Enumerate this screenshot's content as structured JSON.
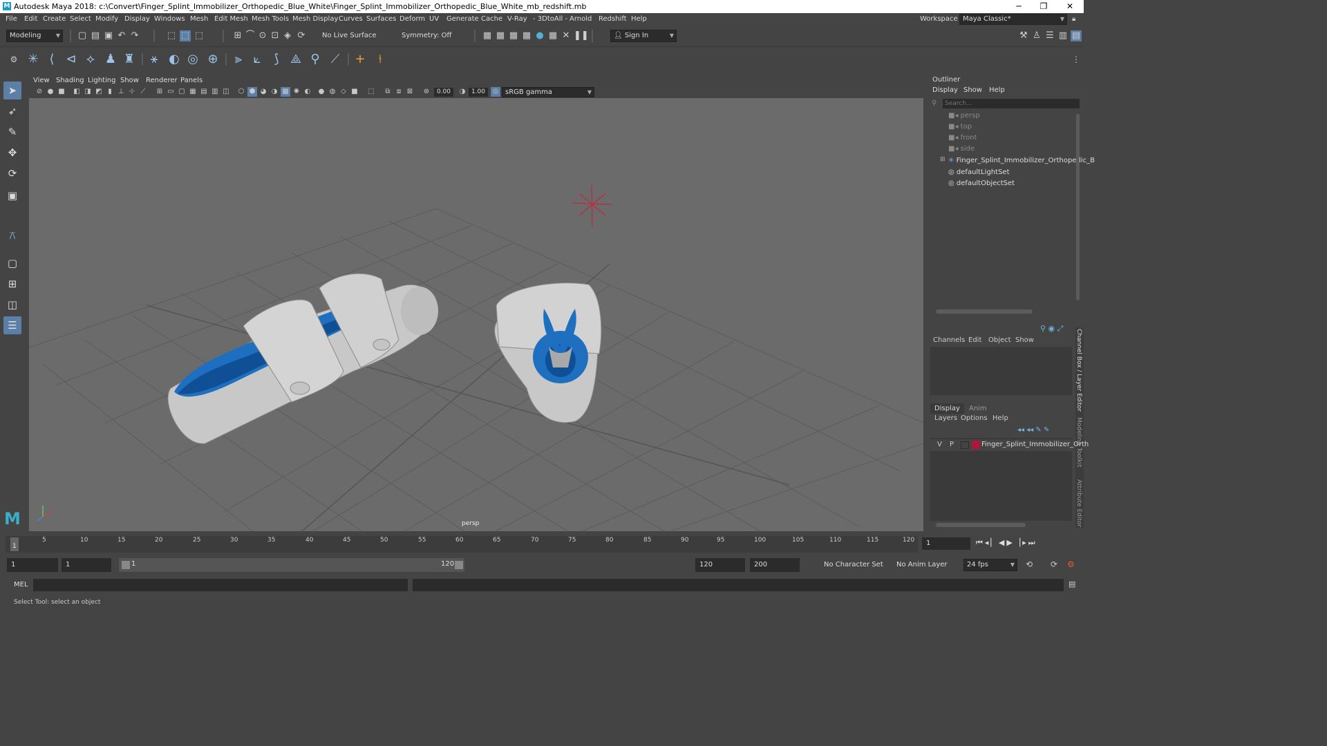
{
  "window": {
    "title": "Autodesk Maya 2018: c:\\Convert\\Finger_Splint_Immobilizer_Orthopedic_Blue_White\\Finger_Splint_Immobilizer_Orthopedic_Blue_White_mb_redshift.mb",
    "logo": "M",
    "minimize": "─",
    "maximize": "❐",
    "close": "✕"
  },
  "menu": [
    "File",
    "Edit",
    "Create",
    "Select",
    "Modify",
    "Display",
    "Windows",
    "Mesh",
    "Edit Mesh",
    "Mesh Tools",
    "Mesh Display",
    "Curves",
    "Surfaces",
    "Deform",
    "UV",
    "Generate",
    "Cache",
    "V-Ray",
    "- 3DtoAll -",
    "Arnold",
    "Redshift",
    "Help"
  ],
  "workspace": {
    "label": "Workspace :",
    "value": "Maya Classic*"
  },
  "toolbar": {
    "mode": "Modeling",
    "live_surface": "No Live Surface",
    "symmetry": "Symmetry: Off",
    "sign_in": "Sign In"
  },
  "viewport": {
    "menus": [
      "View",
      "Shading",
      "Lighting",
      "Show",
      "Renderer",
      "Panels"
    ],
    "exposure": "0.00",
    "gamma": "1.00",
    "colorspace": "sRGB gamma",
    "camera_label": "persp"
  },
  "outliner": {
    "title": "Outliner",
    "menus": [
      "Display",
      "Show",
      "Help"
    ],
    "search_placeholder": "Search...",
    "items": [
      {
        "name": "persp",
        "type": "camera"
      },
      {
        "name": "top",
        "type": "camera"
      },
      {
        "name": "front",
        "type": "camera"
      },
      {
        "name": "side",
        "type": "camera"
      },
      {
        "name": "Finger_Splint_Immobilizer_Orthopedic_B",
        "type": "group"
      },
      {
        "name": "defaultLightSet",
        "type": "set"
      },
      {
        "name": "defaultObjectSet",
        "type": "set"
      }
    ]
  },
  "channelbox": {
    "menus": [
      "Channels",
      "Edit",
      "Object",
      "Show"
    ],
    "side_label": "Channel Box / Layer Editor"
  },
  "layers": {
    "tabs": [
      "Display",
      "Anim"
    ],
    "menus": [
      "Layers",
      "Options",
      "Help"
    ],
    "layer": {
      "v": "V",
      "p": "P",
      "name": "Finger_Splint_Immobilizer_Orth",
      "color": "#b0153a"
    }
  },
  "side_tabs": [
    "Modeling Toolkit",
    "Attribute Editor"
  ],
  "timeline": {
    "ticks": [
      "1",
      "5",
      "10",
      "15",
      "20",
      "25",
      "30",
      "35",
      "40",
      "45",
      "50",
      "55",
      "60",
      "65",
      "70",
      "75",
      "80",
      "85",
      "90",
      "95",
      "100",
      "105",
      "110",
      "115",
      "120"
    ],
    "current_frame": "1"
  },
  "range": {
    "start": "1",
    "start2": "1",
    "slider_start": "1",
    "slider_end": "120",
    "end": "120",
    "end2": "200",
    "character_set": "No Character Set",
    "anim_layer": "No Anim Layer",
    "fps": "24 fps"
  },
  "command": {
    "label": "MEL"
  },
  "help_line": "Select Tool: select an object",
  "colors": {
    "bg": "#444444",
    "viewport": "#6b6b6b",
    "accent": "#5b9fd8",
    "splint_blue": "#1e6fbf",
    "splint_white": "#d8d8d8"
  }
}
